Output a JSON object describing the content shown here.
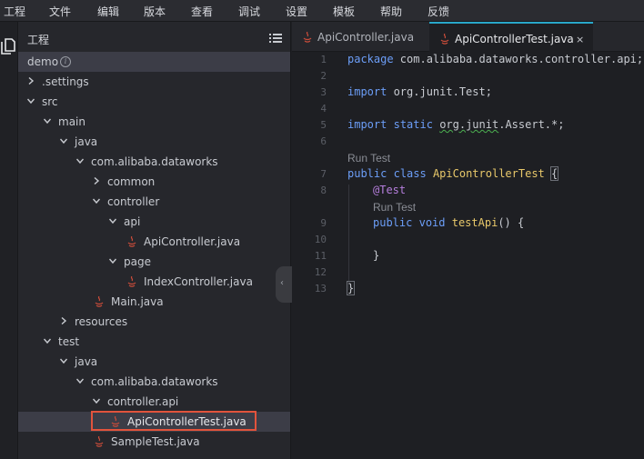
{
  "menubar": {
    "items": [
      "工程",
      "文件",
      "编辑",
      "版本",
      "查看",
      "调试",
      "设置",
      "模板",
      "帮助",
      "反馈"
    ]
  },
  "sidebar": {
    "title": "工程",
    "info_glyph": "i",
    "tree": [
      {
        "label": "demo",
        "depth": 0,
        "kind": "root"
      },
      {
        "label": ".settings",
        "depth": 0,
        "kind": "folder",
        "expanded": false
      },
      {
        "label": "src",
        "depth": 0,
        "kind": "folder",
        "expanded": true
      },
      {
        "label": "main",
        "depth": 1,
        "kind": "folder",
        "expanded": true
      },
      {
        "label": "java",
        "depth": 2,
        "kind": "folder",
        "expanded": true
      },
      {
        "label": "com.alibaba.dataworks",
        "depth": 3,
        "kind": "folder",
        "expanded": true
      },
      {
        "label": "common",
        "depth": 4,
        "kind": "folder",
        "expanded": false
      },
      {
        "label": "controller",
        "depth": 4,
        "kind": "folder",
        "expanded": true
      },
      {
        "label": "api",
        "depth": 5,
        "kind": "folder",
        "expanded": true
      },
      {
        "label": "ApiController.java",
        "depth": 6,
        "kind": "java"
      },
      {
        "label": "page",
        "depth": 5,
        "kind": "folder",
        "expanded": true
      },
      {
        "label": "IndexController.java",
        "depth": 6,
        "kind": "java"
      },
      {
        "label": "Main.java",
        "depth": 4,
        "kind": "java"
      },
      {
        "label": "resources",
        "depth": 2,
        "kind": "folder",
        "expanded": false
      },
      {
        "label": "test",
        "depth": 1,
        "kind": "folder",
        "expanded": true
      },
      {
        "label": "java",
        "depth": 2,
        "kind": "folder",
        "expanded": true
      },
      {
        "label": "com.alibaba.dataworks",
        "depth": 3,
        "kind": "folder",
        "expanded": true
      },
      {
        "label": "controller.api",
        "depth": 4,
        "kind": "folder",
        "expanded": true
      },
      {
        "label": "ApiControllerTest.java",
        "depth": 5,
        "kind": "java",
        "selected": true
      },
      {
        "label": "SampleTest.java",
        "depth": 4,
        "kind": "java"
      }
    ]
  },
  "tabs": [
    {
      "label": "ApiController.java",
      "active": false
    },
    {
      "label": "ApiControllerTest.java",
      "active": true,
      "close": "×"
    }
  ],
  "editor": {
    "line_numbers": [
      "1",
      "2",
      "3",
      "4",
      "5",
      "6",
      "7",
      "8",
      "9",
      "10",
      "11",
      "12",
      "13"
    ],
    "code": {
      "l1_kw": "package",
      "l1_rest": " com.alibaba.dataworks.controller.api;",
      "l3_kw": "import",
      "l3_rest": " org.junit.Test;",
      "l5_kw1": "import",
      "l5_kw2": "static",
      "l5_squig": "org.junit",
      "l5_rest": ".Assert.*;",
      "l7_kw1": "public",
      "l7_kw2": "class",
      "l7_cls": "ApiControllerTest",
      "l7_brace": "{",
      "l8_ann": "@Test",
      "l9_kw1": "public",
      "l9_kw2": "void",
      "l9_fn": "testApi",
      "l9_rest": "() {",
      "l11_brace": "}",
      "l13_brace": "}"
    },
    "codelens": [
      "Run Test",
      "Run Test"
    ]
  },
  "colors": {
    "accent": "#29a7c9",
    "keyword": "#6c9ef8",
    "annotation": "#b57edc",
    "class_name": "#e8c86a",
    "highlight_box": "#e2533c",
    "java_icon": "#c94c3a"
  },
  "icons": {
    "files": "files-icon",
    "sidebar_menu": "list-icon",
    "java_file": "java-file-icon",
    "chevron_right": "chevron-right-icon",
    "chevron_down": "chevron-down-icon",
    "collapse": "chevron-left-icon",
    "close": "close-icon"
  }
}
